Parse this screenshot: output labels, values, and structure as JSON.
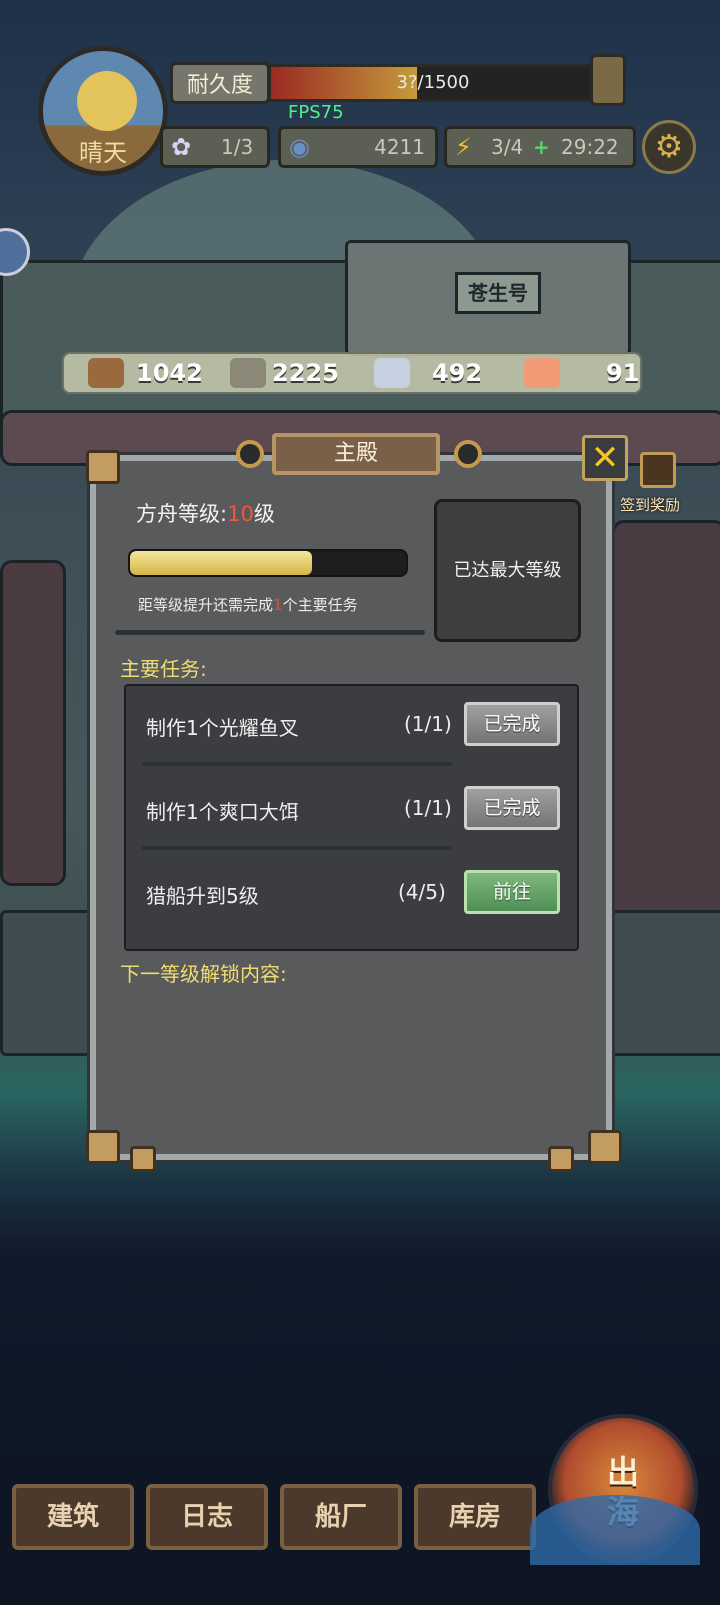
{
  "hud": {
    "weather": "晴天",
    "durability_label": "耐久度",
    "durability_value": "3?/1500",
    "durability_ratio": 0.45,
    "fps": "FPS75",
    "crew": "1/3",
    "coins": "4211",
    "energy": "3/4",
    "energy_plus": "+",
    "timer": "29:22"
  },
  "resources": {
    "wood": "1042",
    "stone": "2225",
    "metal": "492",
    "fish": "91"
  },
  "ship": {
    "name": "苍生号"
  },
  "modal": {
    "title": "主殿",
    "close": "✕",
    "level_prefix": "方舟等级:",
    "level_num": "10",
    "level_suffix": "级",
    "progress": 0.66,
    "req_prefix": "距等级提升还需完成",
    "req_num": "1",
    "req_suffix": "个主要任务",
    "max_level": "已达最大等级",
    "main_tasks_title": "主要任务:",
    "tasks": [
      {
        "name": "制作1个光耀鱼叉",
        "count": "(1/1)",
        "button": "已完成"
      },
      {
        "name": "制作1个爽口大饵",
        "count": "(1/1)",
        "button": "已完成"
      },
      {
        "name": "猎船升到5级",
        "count": "(4/5)",
        "button": "前往"
      }
    ],
    "unlock_title": "下一等级解锁内容:"
  },
  "side": {
    "reward_label": "签到奖励"
  },
  "nav": {
    "buildings": "建筑",
    "log": "日志",
    "shipyard": "船厂",
    "warehouse": "库房",
    "sea_line1": "出",
    "sea_line2": "海"
  },
  "colors": {
    "accent_gold": "#f1dc70",
    "level_red": "#f2543f",
    "go_green": "#4f8f55"
  }
}
